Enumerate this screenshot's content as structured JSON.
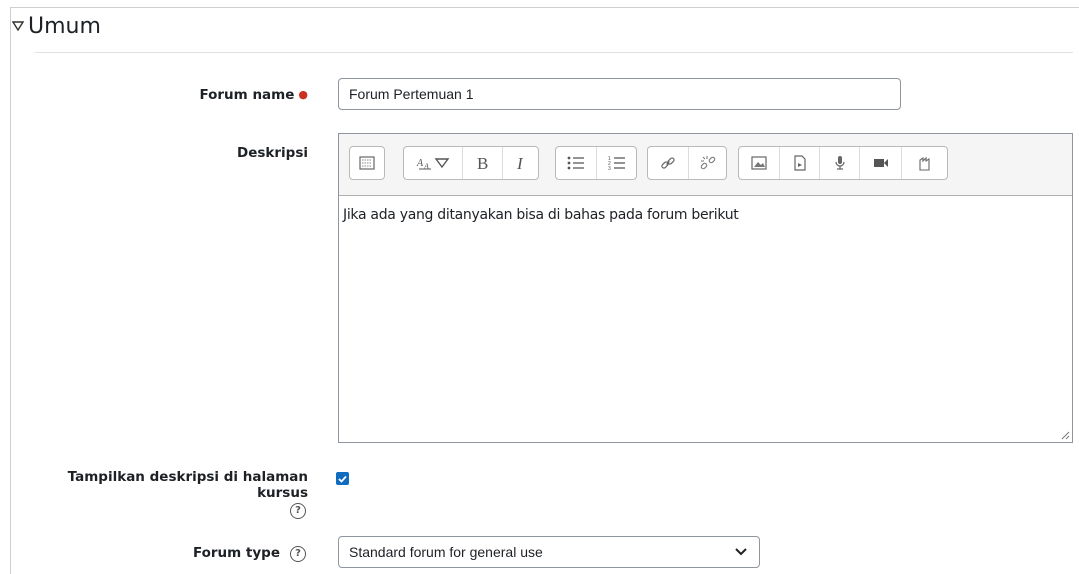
{
  "section": {
    "title": "Umum"
  },
  "forum_name": {
    "label": "Forum name",
    "value": "Forum Pertemuan 1"
  },
  "description": {
    "label": "Deskripsi",
    "content": "Jika ada yang ditanyakan  bisa di bahas pada  forum berikut"
  },
  "show_description": {
    "label": "Tampilkan deskripsi di halaman kursus",
    "checked": true
  },
  "forum_type": {
    "label": "Forum type",
    "value": "Standard forum for general use"
  },
  "colors": {
    "accent": "#0f6cbf",
    "required": "#ca3120"
  }
}
